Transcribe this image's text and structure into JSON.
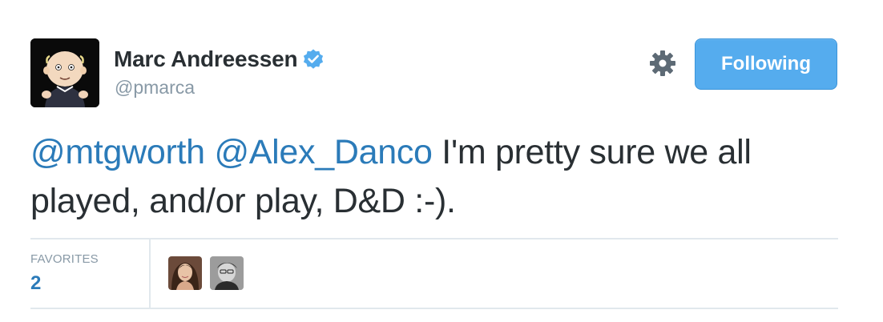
{
  "author": {
    "name": "Marc Andreessen",
    "handle": "@pmarca",
    "verified": true,
    "avatar_icon": "cartoon-avatar-icon"
  },
  "actions": {
    "settings_icon": "gear-icon",
    "follow_label": "Following",
    "follow_color": "#55acee"
  },
  "tweet": {
    "mentions": [
      "@mtgworth",
      "@Alex_Danco"
    ],
    "text_after_mentions": " I'm pretty sure we all played, and/or play, D&D :-).",
    "mention_color": "#2b7bb9"
  },
  "stats": {
    "favorites_label": "FAVORITES",
    "favorites_count": "2",
    "favoriters": [
      {
        "avatar_icon": "user-avatar-icon"
      },
      {
        "avatar_icon": "user-avatar-icon"
      }
    ]
  }
}
